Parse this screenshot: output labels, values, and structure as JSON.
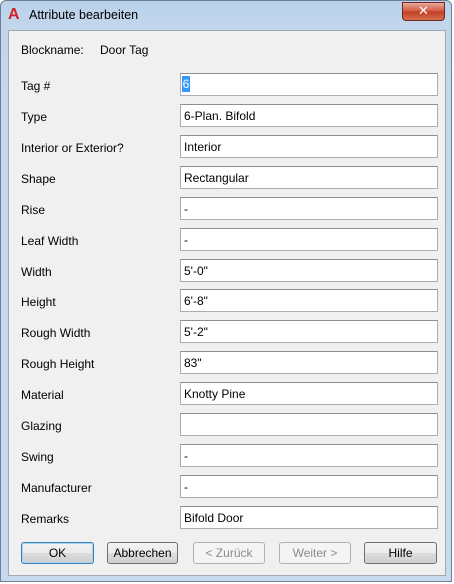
{
  "window": {
    "title": "Attribute bearbeiten",
    "close_glyph": "✕",
    "app_icon": "autocad-icon"
  },
  "block": {
    "label": "Blockname:",
    "value": "Door Tag"
  },
  "attributes": [
    {
      "label": "Tag #",
      "value": "6"
    },
    {
      "label": "Type",
      "value": "6-Plan. Bifold"
    },
    {
      "label": "Interior or Exterior?",
      "value": "Interior"
    },
    {
      "label": "Shape",
      "value": "Rectangular"
    },
    {
      "label": "Rise",
      "value": "-"
    },
    {
      "label": "Leaf Width",
      "value": "-"
    },
    {
      "label": "Width",
      "value": "5'-0\""
    },
    {
      "label": "Height",
      "value": "6'-8\""
    },
    {
      "label": "Rough Width",
      "value": "5'-2\""
    },
    {
      "label": "Rough Height",
      "value": "83\""
    },
    {
      "label": "Material",
      "value": "Knotty Pine"
    },
    {
      "label": "Glazing",
      "value": ""
    },
    {
      "label": "Swing",
      "value": "-"
    },
    {
      "label": "Manufacturer",
      "value": "-"
    },
    {
      "label": "Remarks",
      "value": "Bifold Door"
    }
  ],
  "buttons": {
    "ok": "OK",
    "cancel": "Abbrechen",
    "back": "< Zurück",
    "next": "Weiter >",
    "help": "Hilfe"
  }
}
